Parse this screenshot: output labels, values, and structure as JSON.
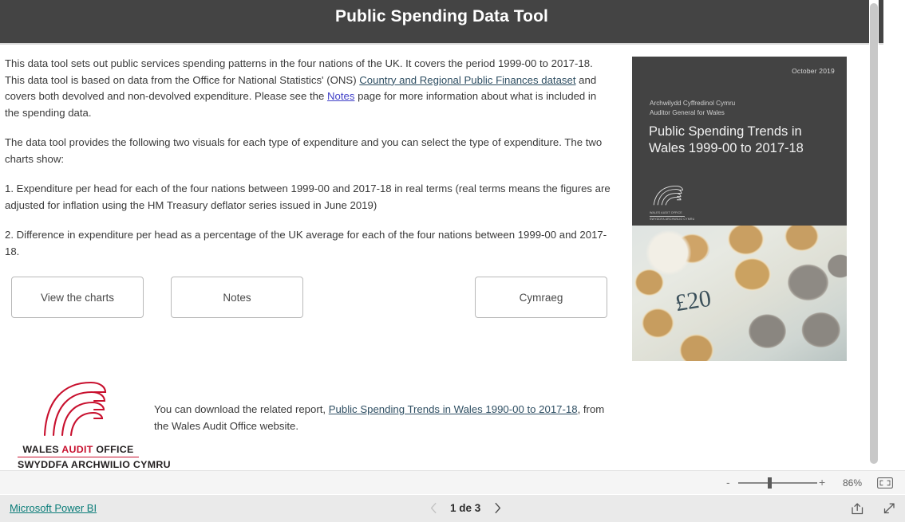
{
  "header": {
    "title": "Public Spending Data Tool"
  },
  "body": {
    "p1_part1": "This data tool sets out public services spending patterns in the four nations of the UK. It covers the period 1999-00 to 2017-18. This data tool is based on data from the Office for National Statistics' (ONS) ",
    "p1_link1": "Country and Regional Public Finances dataset",
    "p1_part2": " and covers both devolved and non-devolved expenditure. Please see the ",
    "p1_link2": "Notes",
    "p1_part3": " page for more information about what is included in the spending data.",
    "p2": "The data tool provides the following two visuals for each type of expenditure and you can select the type of expenditure. The two charts show:",
    "p3": "1. Expenditure per head for each of the four nations between 1999-00 and 2017-18 in real terms (real terms means the figures are adjusted for inflation using the HM Treasury deflator series issued in June 2019)",
    "p4": "2. Difference in expenditure per head as a percentage of the UK average for each of the four nations between 1999-00 and 2017-18."
  },
  "buttons": {
    "view_charts": "View the charts",
    "notes": "Notes",
    "welsh": "Cymraeg"
  },
  "cover": {
    "date": "October 2019",
    "org_welsh": "Archwilydd Cyffredinol Cymru",
    "org_english": "Auditor General for Wales",
    "title": "Public Spending Trends in Wales 1999-00 to 2017-18",
    "logo_line1": "WALES AUDIT OFFICE",
    "logo_line2": "SWYDDFA ARCHWILIO CYMRU",
    "banknote_value": "£20"
  },
  "logo": {
    "line1_word1": "WALES ",
    "line1_word2": "AUDIT",
    "line1_word3": " OFFICE",
    "line2_word1": "SWYDDFA ",
    "line2_word2": "ARCHWILIO",
    "line2_word3": " CYMRU"
  },
  "download": {
    "part1": "You can download the related report, ",
    "link": "Public Spending Trends in Wales 1990-00 to 2017-18",
    "part2": ", from the Wales Audit Office website."
  },
  "zoom_bar": {
    "minus": "-",
    "plus": "+",
    "value": "86%",
    "fit_icon": "fit-to-page-icon"
  },
  "footer": {
    "powerbi": "Microsoft Power BI",
    "pager": "1 de 3",
    "prev_icon": "chevron-left-icon",
    "next_icon": "chevron-right-icon",
    "share_icon": "share-icon",
    "expand_icon": "fullscreen-icon"
  },
  "colors": {
    "banner_bg": "#444444",
    "cover_bg": "#434343",
    "brand_red": "#c8102e",
    "powerbi_teal": "#097c78",
    "link_blue": "#4141c8",
    "link_slate": "#2f4f63"
  }
}
